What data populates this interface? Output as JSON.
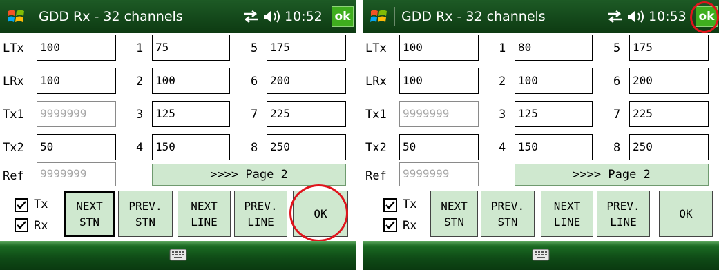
{
  "screens": [
    {
      "title": "GDD Rx - 32 channels",
      "clock": "10:52",
      "title_ok": "ok",
      "labels": {
        "ltx": "LTx",
        "lrx": "LRx",
        "tx1": "Tx1",
        "tx2": "Tx2",
        "ref": "Ref"
      },
      "fields": {
        "ltx": "100",
        "lrx": "100",
        "tx1": "9999999",
        "tx2": "50",
        "ref": "9999999"
      },
      "channels": [
        {
          "num": "1",
          "value": "75"
        },
        {
          "num": "2",
          "value": "100"
        },
        {
          "num": "3",
          "value": "125"
        },
        {
          "num": "4",
          "value": "150"
        },
        {
          "num": "5",
          "value": "175"
        },
        {
          "num": "6",
          "value": "200"
        },
        {
          "num": "7",
          "value": "225"
        },
        {
          "num": "8",
          "value": "250"
        }
      ],
      "page_button": ">>>> Page 2",
      "checks": {
        "tx": "Tx",
        "rx": "Rx",
        "tx_checked": true,
        "rx_checked": true
      },
      "buttons": {
        "next_stn": [
          "NEXT",
          "STN"
        ],
        "prev_stn": [
          "PREV.",
          "STN"
        ],
        "next_line": [
          "NEXT",
          "LINE"
        ],
        "prev_line": [
          "PREV.",
          "LINE"
        ],
        "ok": "OK"
      },
      "focused_button": "next_stn",
      "highlight": "ok-button"
    },
    {
      "title": "GDD Rx - 32 channels",
      "clock": "10:53",
      "title_ok": "ok",
      "labels": {
        "ltx": "LTx",
        "lrx": "LRx",
        "tx1": "Tx1",
        "tx2": "Tx2",
        "ref": "Ref"
      },
      "fields": {
        "ltx": "100",
        "lrx": "100",
        "tx1": "9999999",
        "tx2": "50",
        "ref": "9999999"
      },
      "channels": [
        {
          "num": "1",
          "value": "80"
        },
        {
          "num": "2",
          "value": "100"
        },
        {
          "num": "3",
          "value": "125"
        },
        {
          "num": "4",
          "value": "150"
        },
        {
          "num": "5",
          "value": "175"
        },
        {
          "num": "6",
          "value": "200"
        },
        {
          "num": "7",
          "value": "225"
        },
        {
          "num": "8",
          "value": "250"
        }
      ],
      "page_button": ">>>> Page 2",
      "checks": {
        "tx": "Tx",
        "rx": "Rx",
        "tx_checked": true,
        "rx_checked": true
      },
      "buttons": {
        "next_stn": [
          "NEXT",
          "STN"
        ],
        "prev_stn": [
          "PREV.",
          "STN"
        ],
        "next_line": [
          "NEXT",
          "LINE"
        ],
        "prev_line": [
          "PREV.",
          "LINE"
        ],
        "ok": "OK"
      },
      "focused_button": "",
      "highlight": "title-ok-button"
    }
  ],
  "colors": {
    "titlebar": "#0d3a12",
    "button_fill": "#cfe8cf",
    "ok_badge": "#3fae1e",
    "annotation": "#e0141c"
  },
  "icons": [
    "windows-logo-icon",
    "sync-icon",
    "speaker-icon",
    "keyboard-icon",
    "check-icon"
  ]
}
